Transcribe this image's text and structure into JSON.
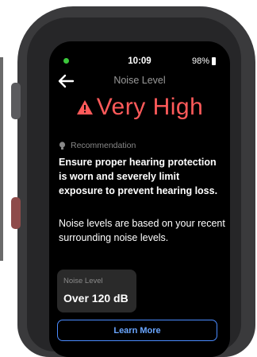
{
  "status": {
    "time": "10:09",
    "battery": "98%"
  },
  "header": {
    "title": "Noise Level",
    "back_icon": "back-arrow-icon"
  },
  "level": {
    "icon": "warning-icon",
    "text": "Very High",
    "color": "#ff5a5a"
  },
  "recommendation": {
    "icon": "lightbulb-icon",
    "label": "Recommendation",
    "text": "Ensure proper hearing protection is worn and severely limit exposure to prevent hearing loss."
  },
  "info": {
    "text": "Noise levels are based on your recent surrounding noise levels."
  },
  "noise_card": {
    "label": "Noise Level",
    "value": "Over 120 dB"
  },
  "actions": {
    "learn_more": "Learn More",
    "accent": "#4a8bff"
  }
}
